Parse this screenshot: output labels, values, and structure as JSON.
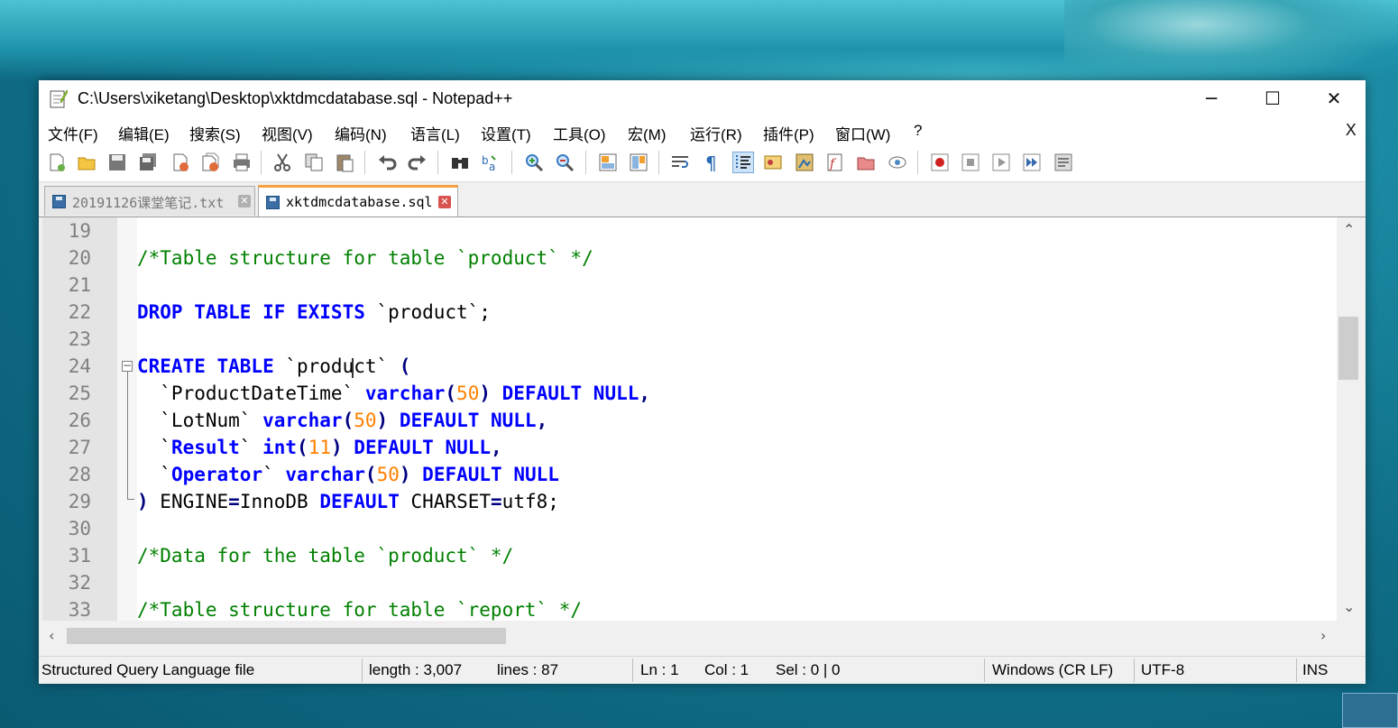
{
  "window": {
    "title": "C:\\Users\\xiketang\\Desktop\\xktdmcdatabase.sql - Notepad++",
    "minimize": "─",
    "maximize": "☐",
    "close": "✕"
  },
  "menu": {
    "items": [
      "文件(F)",
      "编辑(E)",
      "搜索(S)",
      "视图(V)",
      "编码(N)",
      "语言(L)",
      "设置(T)",
      "工具(O)",
      "宏(M)",
      "运行(R)",
      "插件(P)",
      "窗口(W)",
      "?"
    ],
    "close": "X"
  },
  "toolbar": {
    "icons": [
      "new-file-icon",
      "open-file-icon",
      "save-icon",
      "save-all-icon",
      "close-icon",
      "close-all-icon",
      "print-icon",
      "cut-icon",
      "copy-icon",
      "paste-icon",
      "undo-icon",
      "redo-icon",
      "find-icon",
      "replace-icon",
      "zoom-in-icon",
      "zoom-out-icon",
      "sync-vertical-icon",
      "sync-horizontal-icon",
      "word-wrap-icon",
      "show-all-chars-icon",
      "indent-guide-icon",
      "udl-icon",
      "doc-map-icon",
      "function-list-icon",
      "folder-workspace-icon",
      "monitoring-icon",
      "record-macro-icon",
      "stop-macro-icon",
      "play-macro-icon",
      "run-macro-multiple-icon",
      "save-macro-icon"
    ]
  },
  "tabs": [
    {
      "label": "20191126课堂笔记.txt",
      "active": false
    },
    {
      "label": "xktdmcdatabase.sql",
      "active": true
    }
  ],
  "editor": {
    "line_numbers": [
      "19",
      "20",
      "21",
      "22",
      "23",
      "24",
      "25",
      "26",
      "27",
      "28",
      "29",
      "30",
      "31",
      "32",
      "33"
    ]
  },
  "status": {
    "file_type": "Structured Query Language file",
    "length": "length : 3,007",
    "lines": "lines : 87",
    "ln": "Ln : 1",
    "col": "Col : 1",
    "sel": "Sel : 0 | 0",
    "eol": "Windows (CR LF)",
    "encoding": "UTF-8",
    "mode": "INS"
  },
  "colors": {
    "comment": "#008000",
    "keyword": "#0000ff",
    "number": "#ff8000",
    "tab_accent": "#f9a03c"
  }
}
